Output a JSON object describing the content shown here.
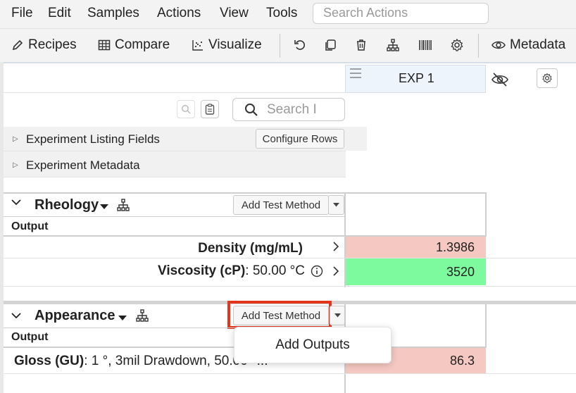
{
  "menu": {
    "file": "File",
    "edit": "Edit",
    "samples": "Samples",
    "actions": "Actions",
    "view": "View",
    "tools": "Tools",
    "search_placeholder": "Search Actions"
  },
  "toolbar": {
    "recipes": "Recipes",
    "compare": "Compare",
    "visualize": "Visualize",
    "metadata": "Metadata"
  },
  "grid": {
    "experiment_column": "EXP 1",
    "search_placeholder": "Search I",
    "experiment_listing_fields": "Experiment Listing Fields",
    "configure_rows": "Configure Rows",
    "experiment_metadata": "Experiment Metadata"
  },
  "sections": [
    {
      "title": "Rheology",
      "add_test_method": "Add Test Method",
      "output_label": "Output",
      "rows": [
        {
          "label": "Density (mg/mL)",
          "condition": "",
          "value": "1.3986",
          "color": "#f6c8c2"
        },
        {
          "label": "Viscosity (cP)",
          "condition": ": 50.00 °C",
          "value": "3520",
          "color": "#7dfa9e"
        }
      ]
    },
    {
      "title": "Appearance",
      "add_test_method": "Add Test Method",
      "output_label": "Output",
      "rows": [
        {
          "label": "Gloss (GU)",
          "condition": ": 1 °, 3mil Drawdown, 50.00 °...",
          "value": "86.3",
          "color": "#f6c8c2"
        }
      ]
    }
  ],
  "popup": {
    "add_outputs": "Add Outputs"
  },
  "colors": {
    "highlight": "#e5361b",
    "exp_header_bg": "#eef4fb"
  }
}
